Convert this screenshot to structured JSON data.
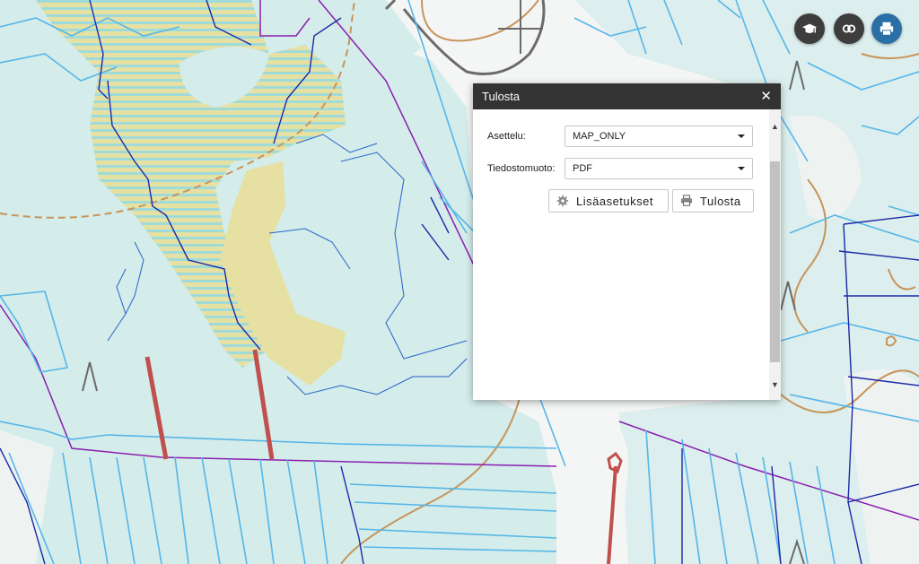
{
  "toolbar": {
    "icons": [
      "graduation-cap-icon",
      "layers-icon",
      "print-icon"
    ],
    "colors": {
      "dark": "#3d3d3d",
      "active": "#2a6fa6"
    }
  },
  "dialog": {
    "title": "Tulosta",
    "close_label": "✕",
    "fields": {
      "layout_label": "Asettelu:",
      "layout_value": "MAP_ONLY",
      "format_label": "Tiedostomuoto:",
      "format_value": "PDF"
    },
    "buttons": {
      "settings_label": "Lisäasetukset",
      "print_label": "Tulosta"
    }
  },
  "map": {
    "colors": {
      "background": "#f4f6f5",
      "water_area": "#d4ecea",
      "marsh": "#e6e0a2",
      "stream": "#56b6e8",
      "ditch_dark": "#1b2aa8",
      "boundary": "#8a1fb0",
      "road": "#c7955b",
      "power_line": "#c0504d"
    }
  }
}
